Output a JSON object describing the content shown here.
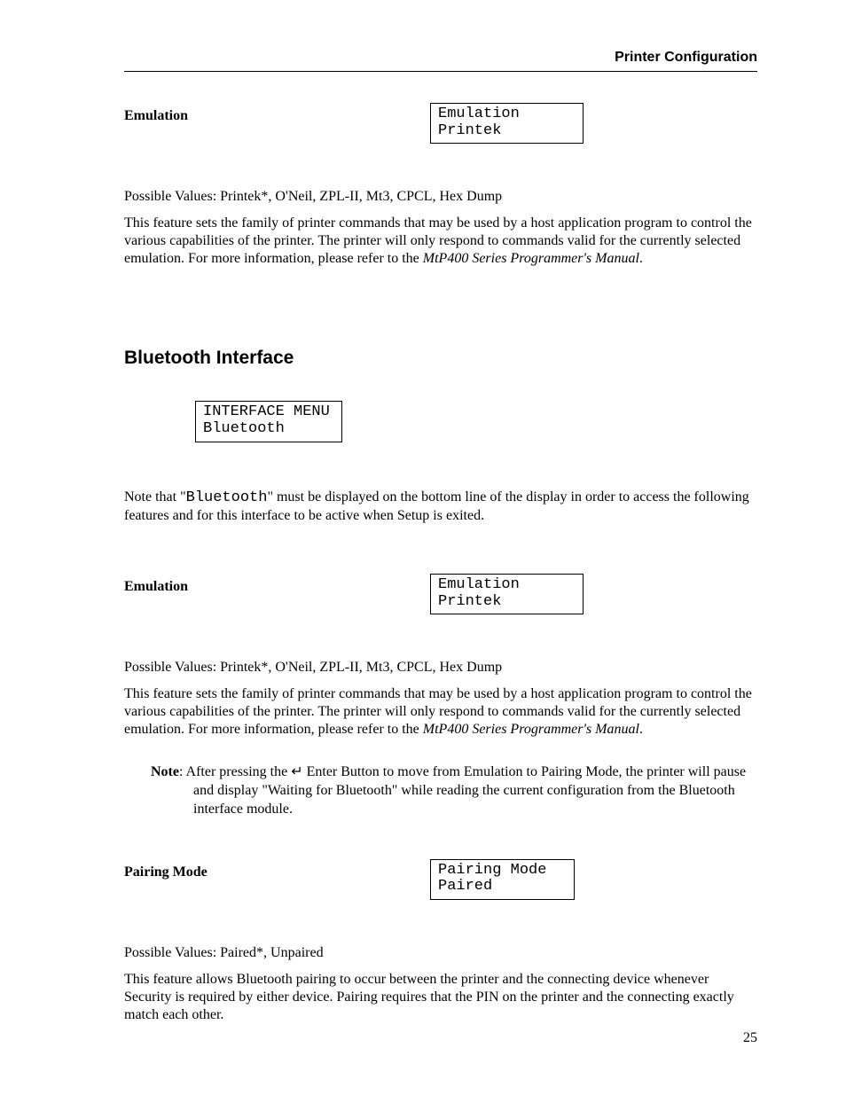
{
  "header": {
    "title": "Printer Configuration"
  },
  "page_number": "25",
  "emulation1": {
    "label": "Emulation",
    "lcd_line1": "Emulation",
    "lcd_line2": "Printek",
    "possible": "Possible Values:  Printek*, O'Neil, ZPL-II, Mt3, CPCL, Hex Dump",
    "desc_a": "This feature sets the family of printer commands that may be used by a host application program to control the various capabilities of the printer.  The printer will only respond to commands valid for the currently selected emulation.  For more information, please refer to the ",
    "manual": "MtP400 Series Programmer's Manual",
    "desc_b": "."
  },
  "bt_section": {
    "heading": "Bluetooth Interface",
    "menu_lcd_line1": "INTERFACE MENU",
    "menu_lcd_line2": "Bluetooth",
    "note_a": "Note that \"",
    "note_mono": "Bluetooth",
    "note_b": "\" must be displayed on the bottom line of the display in order to access the following features and for this interface to be active when Setup is exited."
  },
  "emulation2": {
    "label": "Emulation",
    "lcd_line1": "Emulation",
    "lcd_line2": "Printek",
    "possible": "Possible Values:  Printek*, O'Neil, ZPL-II, Mt3, CPCL, Hex Dump",
    "desc_a": "This feature sets the family of printer commands that may be used by a host application program to control the various capabilities of the printer.  The printer will only respond to commands valid for the currently selected emulation.  For more information, please refer to the ",
    "manual": "MtP400 Series Programmer's Manual",
    "desc_b": "."
  },
  "note": {
    "label": "Note",
    "a": ": After pressing the ",
    "icon": "↵",
    "b": " Enter Button to move from Emulation to Pairing Mode, the printer will pause and display \"Waiting for Bluetooth\" while reading the current configuration from the Bluetooth interface module."
  },
  "pairing": {
    "label": "Pairing Mode",
    "lcd_line1": "Pairing Mode",
    "lcd_line2": "Paired",
    "possible": "Possible Values:  Paired*, Unpaired",
    "desc": "This feature allows Bluetooth pairing to occur between the printer and the connecting device whenever Security is required by either device.  Pairing requires that the PIN on the printer and the connecting exactly match each other."
  }
}
